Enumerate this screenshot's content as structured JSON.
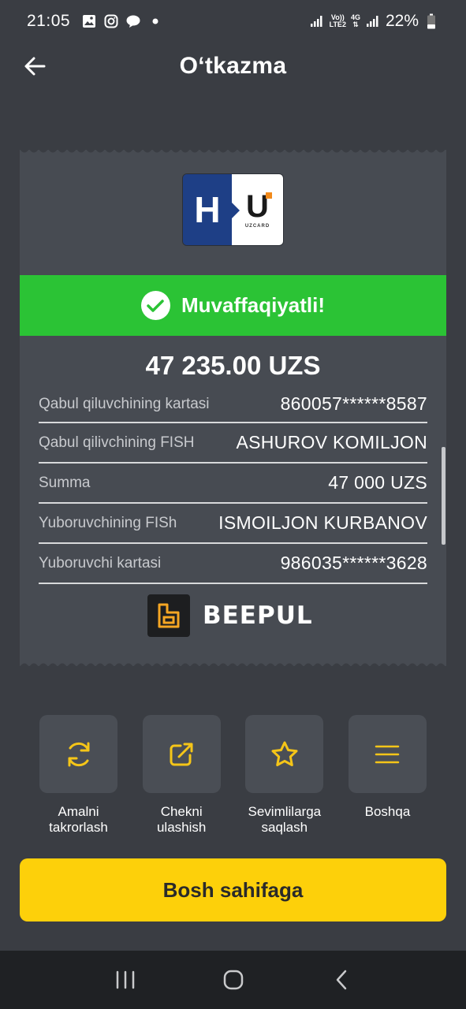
{
  "status_bar": {
    "time": "21:05",
    "battery": "22%",
    "volte": "Vo))",
    "lte": "LTE2",
    "network": "4G"
  },
  "header": {
    "title": "O‘tkazma"
  },
  "receipt": {
    "logo": {
      "letter_h": "H",
      "letter_u": "U",
      "brand": "UZCARD"
    },
    "status_text": "Muvaffaqiyatli!",
    "total": "47 235.00 UZS",
    "rows": [
      {
        "label": "Qabul qiluvchining kartasi",
        "value": "860057******8587"
      },
      {
        "label": "Qabul qilivchining FISH",
        "value": "ASHUROV KOMILJON"
      },
      {
        "label": "Summa",
        "value": "47 000 UZS"
      },
      {
        "label": "Yuboruvchining  FISh",
        "value": "ISMOILJON KURBANOV"
      },
      {
        "label": "Yuboruvchi kartasi",
        "value": "986035******3628"
      }
    ],
    "provider": "BEEPUL"
  },
  "actions": [
    {
      "label": "Amalni\ntakrorlash",
      "icon": "refresh-icon"
    },
    {
      "label": "Chekni\nulashish",
      "icon": "share-icon"
    },
    {
      "label": "Sevimlilarga\nsaqlash",
      "icon": "star-icon"
    },
    {
      "label": "Boshqa",
      "icon": "menu-icon"
    }
  ],
  "home_button_label": "Bosh sahifaga",
  "colors": {
    "background": "#3a3d43",
    "receipt": "#474b52",
    "success": "#2bc335",
    "accent": "#fdd00a",
    "icon_accent": "#f5c518"
  }
}
